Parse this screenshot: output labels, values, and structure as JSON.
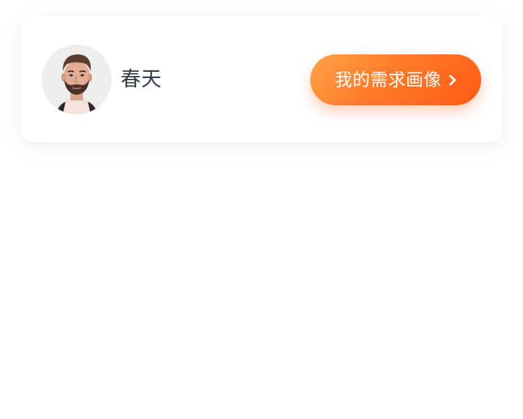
{
  "user": {
    "name": "春天"
  },
  "actions": {
    "profile_button_label": "我的需求画像"
  },
  "icons": {
    "avatar": "user-avatar-photo",
    "button_arrow": "chevron-right-icon"
  },
  "colors": {
    "button_gradient_start": "#ffa24a",
    "button_gradient_end": "#ff5a14",
    "name_text": "#333b47",
    "card_background": "#ffffff"
  }
}
